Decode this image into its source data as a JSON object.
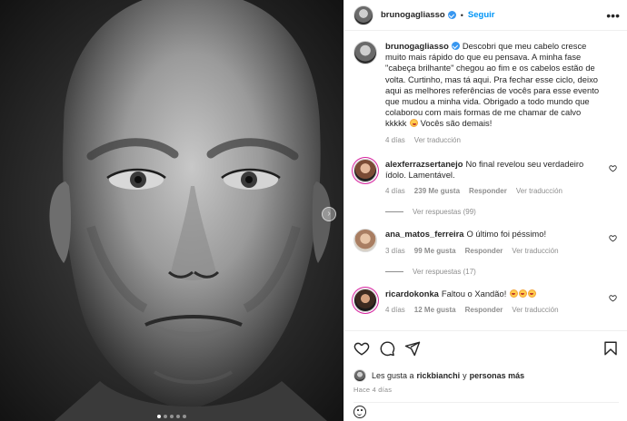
{
  "post": {
    "username": "brunogagliasso",
    "follow_label": "Seguir",
    "more_label": "•••",
    "caption": {
      "username": "brunogagliasso",
      "text": "Descobri que meu cabelo cresce muito mais rápido do que eu pensava. A minha fase \"cabeça brilhante\" chegou ao fim e os cabelos estão de volta. Curtinho, mas tá aqui. Pra fechar esse ciclo, deixo aqui as melhores referências de vocês para esse evento que mudou a minha vida. Obrigado a todo mundo que colaborou com mais formas de me chamar de calvo kkkkk",
      "text_end": "Vocês são demais!",
      "time": "4 días",
      "translate": "Ver traducción"
    }
  },
  "comments": [
    {
      "username": "alexferrazsertanejo",
      "text": "No final revelou seu verdadeiro ídolo. Lamentável.",
      "time": "4 días",
      "likes": "239 Me gusta",
      "reply": "Responder",
      "translate": "Ver traducción",
      "replies": "Ver respuestas (99)"
    },
    {
      "username": "ana_matos_ferreira",
      "text": "O último foi péssimo!",
      "time": "3 días",
      "likes": "99 Me gusta",
      "reply": "Responder",
      "translate": "Ver traducción",
      "replies": "Ver respuestas (17)"
    },
    {
      "username": "ricardokonka",
      "text": "Faltou o Xandão!",
      "time": "4 días",
      "likes": "12 Me gusta",
      "reply": "Responder",
      "translate": "Ver traducción"
    }
  ],
  "footer": {
    "liked_prefix": "Les gusta a",
    "liked_user": "rickbianchi",
    "liked_and": "y",
    "liked_others": "personas más",
    "date": "Hace 4 días"
  },
  "colors": {
    "follow": "#0095f6",
    "meta": "#8e8e8e",
    "verified": "#3897f0"
  },
  "icons": [
    "heart-icon",
    "comment-icon",
    "share-icon",
    "bookmark-icon",
    "more-icon",
    "next-arrow-icon",
    "emoji-icon"
  ]
}
